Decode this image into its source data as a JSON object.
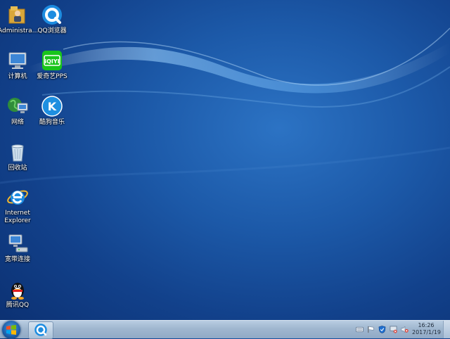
{
  "desktop": {
    "icons": [
      {
        "label": "Administra...",
        "icon": "user-folder-icon"
      },
      {
        "label": "QQ浏览器",
        "icon": "qq-browser-icon"
      },
      {
        "label": "计算机",
        "icon": "computer-icon"
      },
      {
        "label": "爱奇艺PPS",
        "icon": "iqiyi-icon"
      },
      {
        "label": "网络",
        "icon": "network-icon"
      },
      {
        "label": "酷狗音乐",
        "icon": "kugou-icon"
      },
      {
        "label": "回收站",
        "icon": "recycle-bin-icon"
      },
      {
        "label": "Internet\nExplorer",
        "icon": "internet-explorer-icon"
      },
      {
        "label": "宽带连接",
        "icon": "broadband-connection-icon"
      },
      {
        "label": "腾讯QQ",
        "icon": "tencent-qq-icon"
      }
    ],
    "iqiyi_text": "iQIYI",
    "kugou_letter": "K"
  },
  "taskbar": {
    "clock_time": "16:26",
    "clock_date": "2017/1/19",
    "pinned": [
      "qq-browser-icon"
    ],
    "tray_icons": [
      "keyboard-icon",
      "flag-icon",
      "shield-icon",
      "network-warning-icon",
      "volume-muted-icon"
    ]
  },
  "colors": {
    "wallpaper": "#1c59a8",
    "taskbar": "#a9bfd7",
    "iqiyi_green": "#19c51b",
    "kugou_blue": "#1e8fe0"
  }
}
